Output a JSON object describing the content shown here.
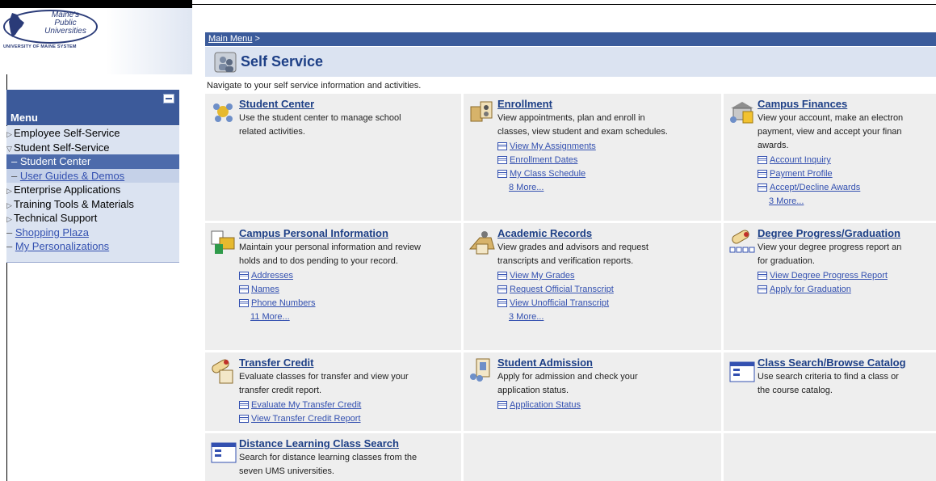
{
  "logo": {
    "line1": "Maine's",
    "line2": "Public",
    "line3": "Universities",
    "subline": "UNIVERSITY OF MAINE SYSTEM"
  },
  "menu": {
    "title": "Menu",
    "items": [
      {
        "label": "Employee Self-Service",
        "marker": "▷"
      },
      {
        "label": "Student Self-Service",
        "marker": "▽"
      },
      {
        "label": "Student Center",
        "marker": "–"
      },
      {
        "label": "User Guides & Demos",
        "marker": "–"
      },
      {
        "label": "Enterprise Applications",
        "marker": "▷"
      },
      {
        "label": "Training Tools & Materials",
        "marker": "▷"
      },
      {
        "label": "Technical Support",
        "marker": "▷"
      },
      {
        "label": "Shopping Plaza",
        "marker": "–"
      },
      {
        "label": "My Personalizations",
        "marker": "–"
      }
    ]
  },
  "breadcrumb": {
    "link": "Main Menu",
    "separator": ">"
  },
  "page": {
    "title": "Self Service",
    "instructions": "Navigate to your self service information and activities."
  },
  "cards": [
    {
      "title": "Student Center",
      "desc": [
        "Use the student center to manage school",
        "related activities."
      ],
      "links": [],
      "more": ""
    },
    {
      "title": "Enrollment",
      "desc": [
        "View appointments, plan and enroll in",
        "classes, view student and exam schedules."
      ],
      "links": [
        "View My Assignments",
        "Enrollment Dates",
        "My Class Schedule"
      ],
      "more": "8 More..."
    },
    {
      "title": "Campus Finances",
      "desc": [
        "View your account, make an electron",
        "payment, view and accept your finan",
        "awards."
      ],
      "links": [
        "Account Inquiry",
        "Payment Profile",
        "Accept/Decline Awards"
      ],
      "more": "3 More..."
    },
    {
      "title": "Campus Personal Information",
      "desc": [
        "Maintain your personal information and review",
        "holds and to dos pending to your record."
      ],
      "links": [
        "Addresses",
        "Names",
        "Phone Numbers"
      ],
      "more": "11 More..."
    },
    {
      "title": "Academic Records",
      "desc": [
        "View grades and advisors and request",
        "transcripts and verification reports."
      ],
      "links": [
        "View My Grades",
        "Request Official Transcript",
        "View Unofficial Transcript"
      ],
      "more": "3 More..."
    },
    {
      "title": "Degree Progress/Graduation",
      "desc": [
        "View your degree progress report an",
        "for graduation."
      ],
      "links": [
        "View Degree Progress Report",
        "Apply for Graduation"
      ],
      "more": ""
    },
    {
      "title": "Transfer Credit",
      "desc": [
        "Evaluate classes for transfer and view your",
        "transfer credit report."
      ],
      "links": [
        "Evaluate My Transfer Credit",
        "View Transfer Credit Report"
      ],
      "more": ""
    },
    {
      "title": "Student Admission",
      "desc": [
        "Apply for admission and check your",
        "application status."
      ],
      "links": [
        "Application Status"
      ],
      "more": ""
    },
    {
      "title": "Class Search/Browse Catalog",
      "desc": [
        "Use search criteria to find a class or",
        "the course catalog."
      ],
      "links": [],
      "more": ""
    },
    {
      "title": "Distance Learning Class Search",
      "desc": [
        "Search for distance learning classes from the",
        "seven UMS universities."
      ],
      "links": [],
      "more": ""
    }
  ]
}
